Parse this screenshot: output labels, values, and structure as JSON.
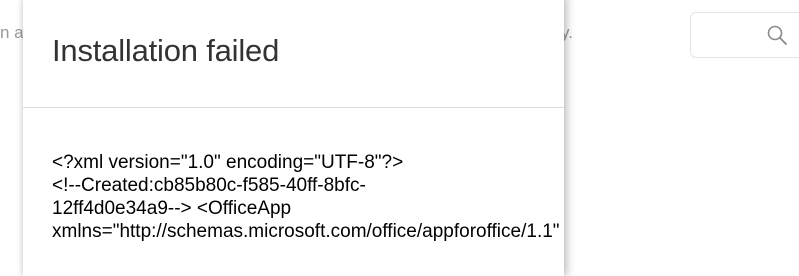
{
  "background": {
    "left_text_fragment": "n a",
    "right_text_fragment": "licy."
  },
  "search": {
    "icon": "search-icon",
    "placeholder": ""
  },
  "dialog": {
    "title": "Installation failed",
    "body_lines": [
      "<?xml version=\"1.0\" encoding=\"UTF-8\"?>",
      "<!--Created:cb85b80c-f585-40ff-8bfc-",
      "12ff4d0e34a9--> <OfficeApp",
      "xmlns=\"http://schemas.microsoft.com/office/appforoffice/1.1\""
    ]
  },
  "colors": {
    "title": "#333333",
    "body_text": "#000000",
    "background_text": "#9a9a9a",
    "divider": "#dcdcdc"
  }
}
